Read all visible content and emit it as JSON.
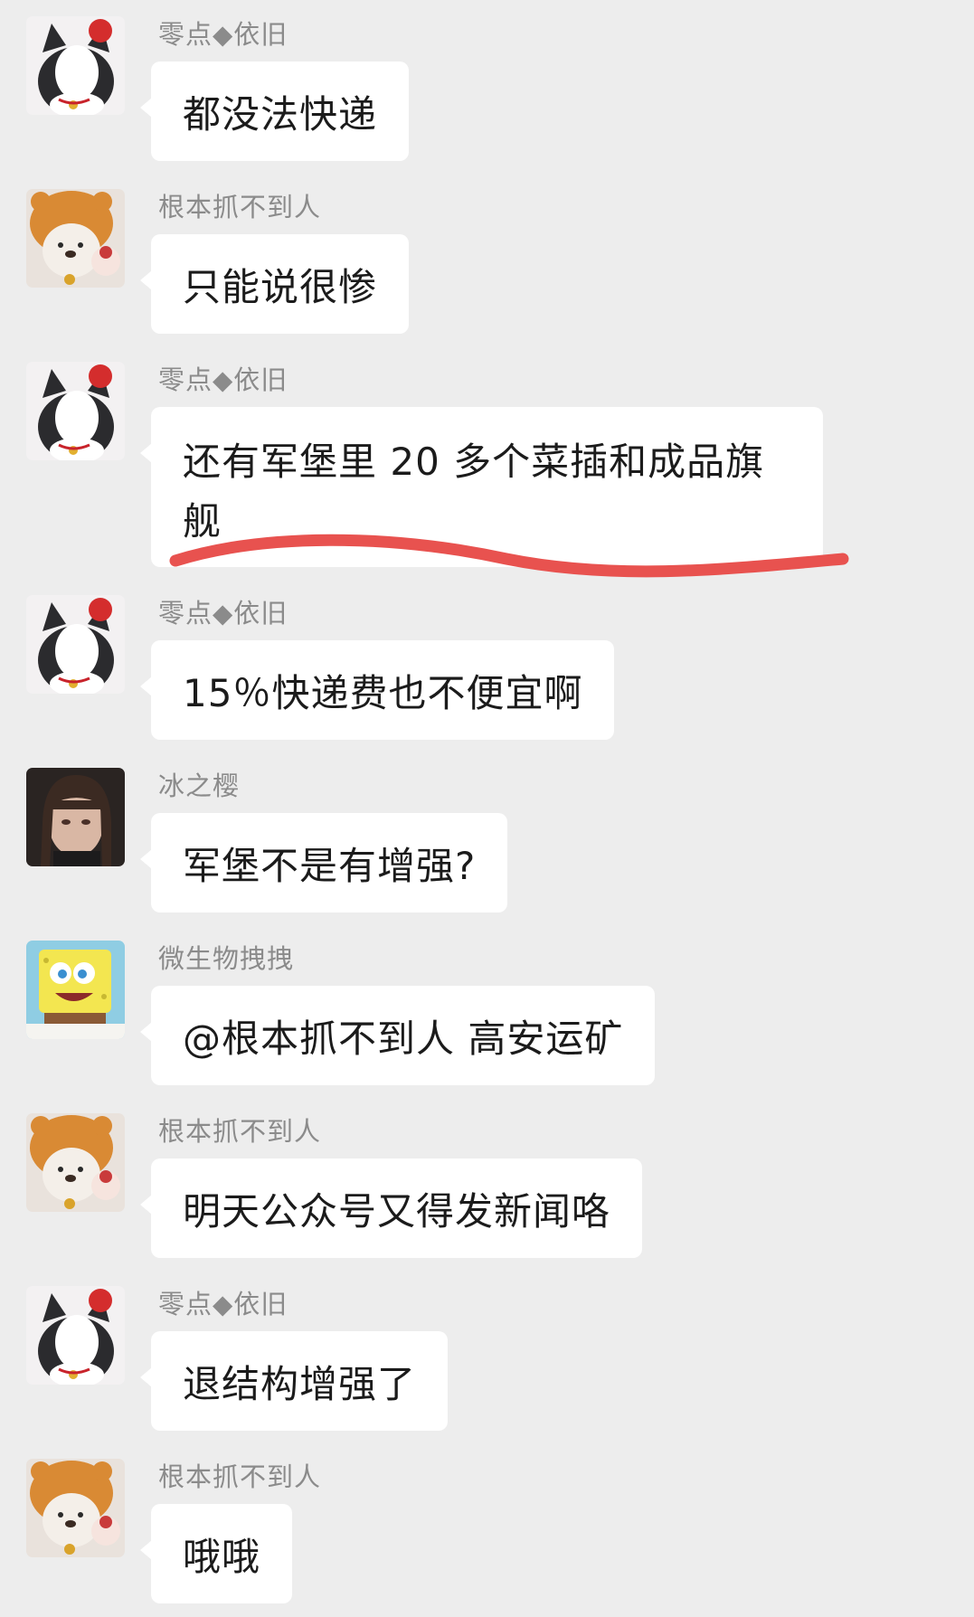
{
  "messages": [
    {
      "sender": "零点◆依旧",
      "text": "都没法快递",
      "avatar": "black-white-cat-avatar"
    },
    {
      "sender": "根本抓不到人",
      "text": "只能说很惨",
      "avatar": "bear-hat-plush-avatar"
    },
    {
      "sender": "零点◆依旧",
      "text": "还有军堡里 20 多个菜插和成品旗舰",
      "avatar": "black-white-cat-avatar"
    },
    {
      "sender": "零点◆依旧",
      "text": "15％快递费也不便宜啊",
      "avatar": "black-white-cat-avatar"
    },
    {
      "sender": "冰之樱",
      "text": "军堡不是有增强?",
      "avatar": "anime-girl-avatar"
    },
    {
      "sender": "微生物拽拽",
      "text": "@根本抓不到人  高安运矿",
      "avatar": "spongebob-avatar"
    },
    {
      "sender": "根本抓不到人",
      "text": "明天公众号又得发新闻咯",
      "avatar": "bear-hat-plush-avatar"
    },
    {
      "sender": "零点◆依旧",
      "text": "退结构增强了",
      "avatar": "black-white-cat-avatar"
    },
    {
      "sender": "根本抓不到人",
      "text": "哦哦",
      "avatar": "bear-hat-plush-avatar"
    }
  ],
  "colors": {
    "background": "#ededed",
    "bubble": "#ffffff",
    "sender_text": "#8b8b8b",
    "message_text": "#1b1b1b",
    "annotation_underline": "#e8524f"
  }
}
